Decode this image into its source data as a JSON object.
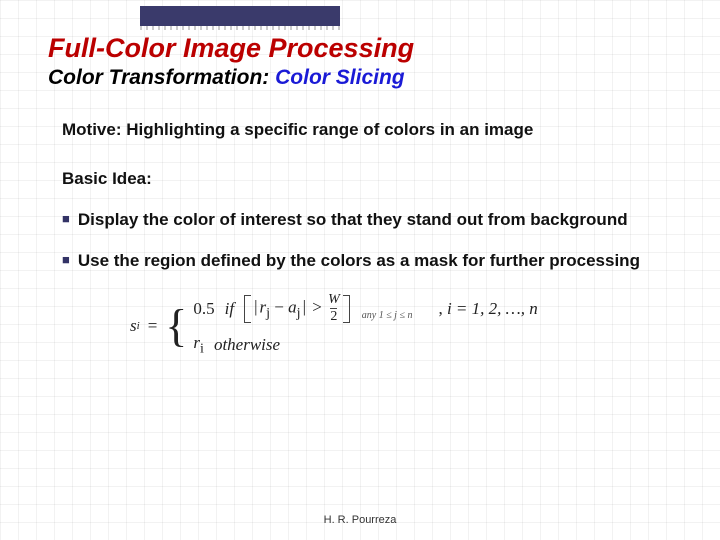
{
  "title": "Full-Color Image Processing",
  "subtitle": {
    "transform_label": "Color Transformation: ",
    "slicing_label": "Color Slicing"
  },
  "motive": "Motive: Highlighting a specific range of colors in an image",
  "idea_head": "Basic Idea:",
  "bullets": {
    "b1": "Display the color of interest so that they stand out from background",
    "b2": "Use the region defined by the colors as a mask for further processing"
  },
  "formula": {
    "lhs_var": "s",
    "lhs_sub": "i",
    "eq": "=",
    "case1_value": "0.5",
    "if_word": "if",
    "abs_rj": "r",
    "abs_rj_sub": "j",
    "minus": "−",
    "abs_aj": "a",
    "abs_aj_sub": "j",
    "gt": ">",
    "frac_num": "W",
    "frac_den": "2",
    "cond_sub": "any 1 ≤ j ≤ n",
    "comma": ",",
    "tail_range": " i = 1, 2, …, n",
    "case2_rvar": "r",
    "case2_rsub": "i",
    "otherwise": "otherwise"
  },
  "footer": "H. R. Pourreza"
}
